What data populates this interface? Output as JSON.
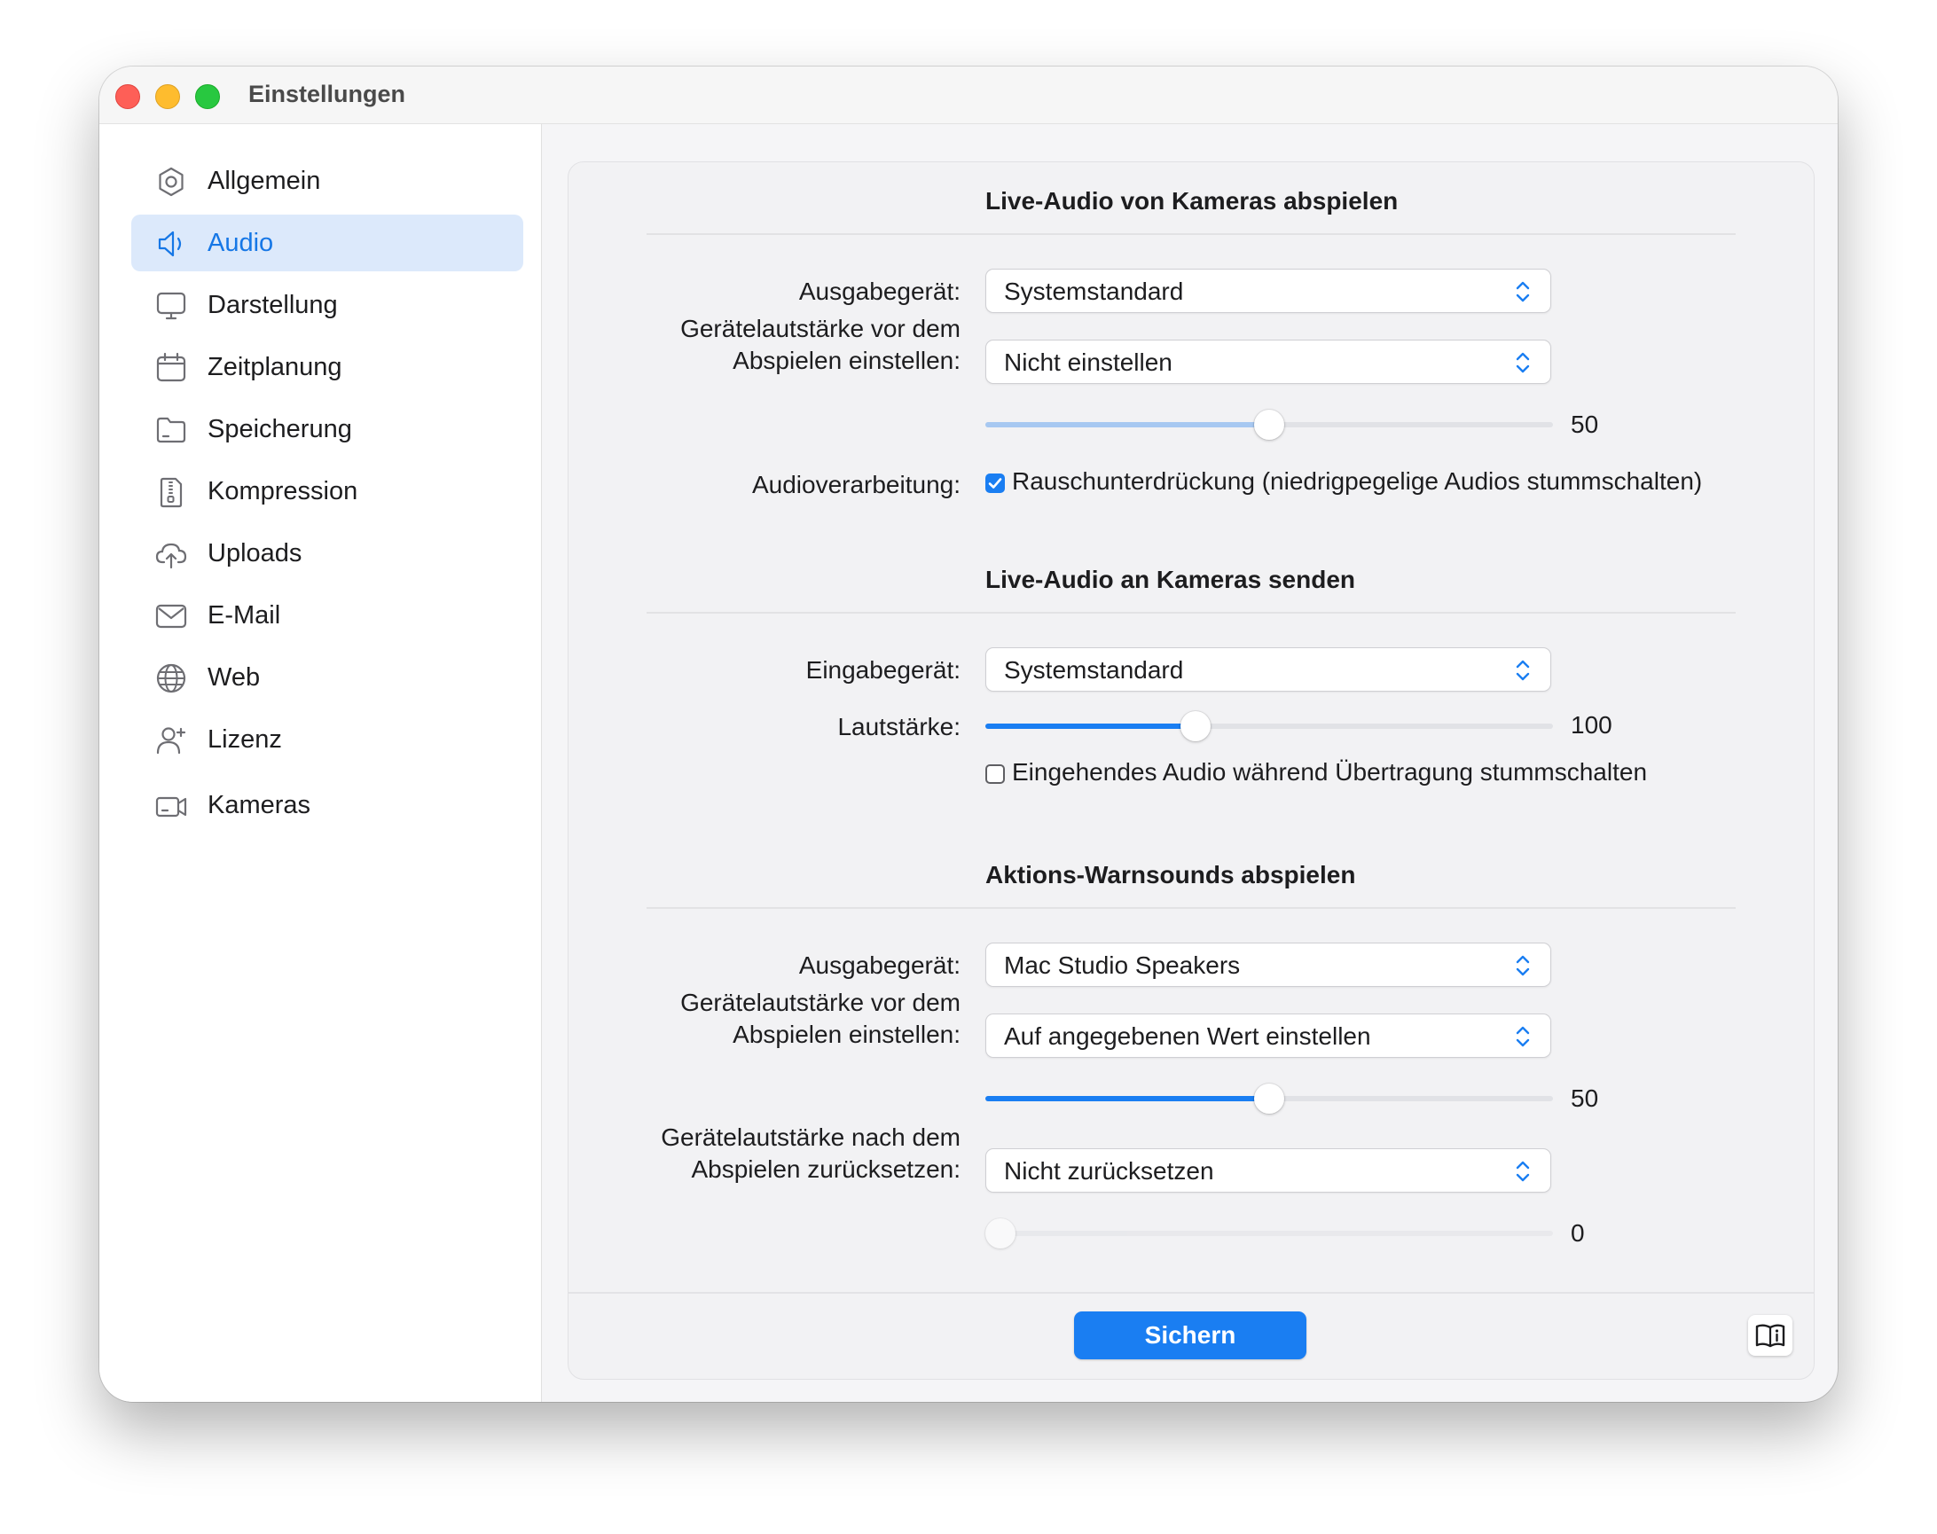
{
  "window": {
    "title": "Einstellungen"
  },
  "sidebar": {
    "items": [
      {
        "label": "Allgemein",
        "icon": "gear-icon",
        "active": false
      },
      {
        "label": "Audio",
        "icon": "speaker-icon",
        "active": true
      },
      {
        "label": "Darstellung",
        "icon": "display-icon",
        "active": false
      },
      {
        "label": "Zeitplanung",
        "icon": "calendar-icon",
        "active": false
      },
      {
        "label": "Speicherung",
        "icon": "folder-icon",
        "active": false
      },
      {
        "label": "Kompression",
        "icon": "zip-file-icon",
        "active": false
      },
      {
        "label": "Uploads",
        "icon": "cloud-upload-icon",
        "active": false
      },
      {
        "label": "E-Mail",
        "icon": "envelope-icon",
        "active": false
      },
      {
        "label": "Web",
        "icon": "globe-icon",
        "active": false
      },
      {
        "label": "Lizenz",
        "icon": "person-add-icon",
        "active": false
      },
      {
        "label": "Kameras",
        "icon": "video-camera-icon",
        "active": false
      }
    ]
  },
  "sections": {
    "play": {
      "title": "Live-Audio von Kameras abspielen",
      "output_label": "Ausgabegerät:",
      "output_value": "Systemstandard",
      "volume_before_label_1": "Gerätelautstärke vor dem",
      "volume_before_label_2": "Abspielen einstellen:",
      "volume_before_value": "Nicht einstellen",
      "volume_before_level": 50,
      "volume_before_level_text": "50",
      "processing_label": "Audioverarbeitung:",
      "noise_label": "Rauschunterdrückung (niedrigpegelige Audios stummschalten)",
      "noise_checked": true
    },
    "send": {
      "title": "Live-Audio an Kameras senden",
      "input_label": "Eingabegerät:",
      "input_value": "Systemstandard",
      "volume_label": "Lautstärke:",
      "volume_level": 100,
      "volume_level_text": "100",
      "mute_label": "Eingehendes Audio während Übertragung stummschalten",
      "mute_checked": false
    },
    "alerts": {
      "title": "Aktions-Warnsounds abspielen",
      "output_label": "Ausgabegerät:",
      "output_value": "Mac Studio Speakers",
      "volume_before_label_1": "Gerätelautstärke vor dem",
      "volume_before_label_2": "Abspielen einstellen:",
      "volume_before_value": "Auf angegebenen Wert einstellen",
      "volume_before_level": 50,
      "volume_before_level_text": "50",
      "volume_after_label_1": "Gerätelautstärke nach dem",
      "volume_after_label_2": "Abspielen zurücksetzen:",
      "volume_after_value": "Nicht zurücksetzen",
      "volume_after_level": 0,
      "volume_after_level_text": "0"
    }
  },
  "footer": {
    "save_label": "Sichern",
    "help_icon": "book-info-icon"
  },
  "colors": {
    "accent": "#1a7ef2",
    "sidebar_active_bg": "#dce9fb"
  }
}
